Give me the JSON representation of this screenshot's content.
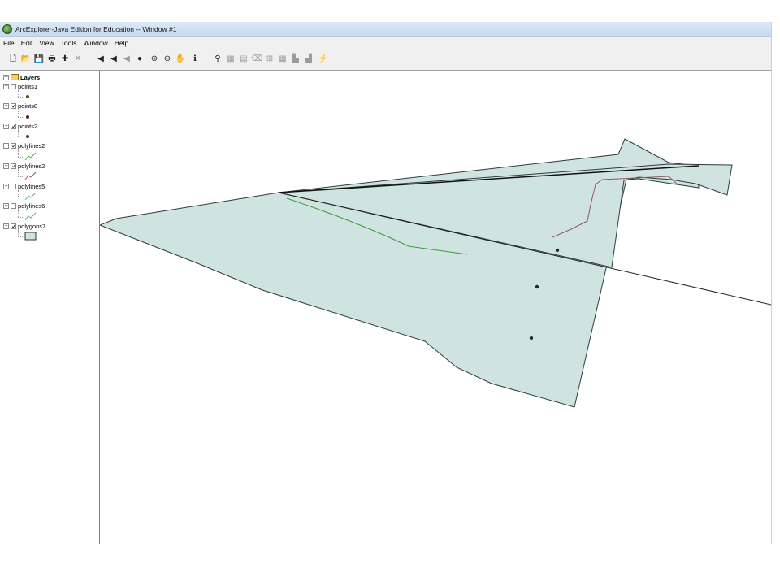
{
  "window": {
    "title": "ArcExplorer-Java Edition for Education -- Window #1"
  },
  "menu": [
    "File",
    "Edit",
    "View",
    "Tools",
    "Window",
    "Help"
  ],
  "toolbar": {
    "buttons": [
      {
        "name": "new-icon",
        "glyph": "🗋"
      },
      {
        "name": "open-folder-icon",
        "glyph": "📂"
      },
      {
        "name": "save-icon",
        "glyph": "💾"
      },
      {
        "name": "print-icon",
        "glyph": "🖶"
      },
      {
        "name": "add-layer-icon",
        "glyph": "✚"
      },
      {
        "name": "delete-icon",
        "glyph": "✕",
        "dim": true
      },
      {
        "name": "back-arrow-icon",
        "glyph": "◀"
      },
      {
        "name": "previous-extent-icon",
        "glyph": "◀"
      },
      {
        "name": "next-extent-icon",
        "glyph": "◀",
        "dim": true
      },
      {
        "name": "full-extent-globe-icon",
        "glyph": "●"
      },
      {
        "name": "zoom-in-icon",
        "glyph": "⊕"
      },
      {
        "name": "zoom-out-icon",
        "glyph": "⊖"
      },
      {
        "name": "pan-hand-icon",
        "glyph": "✋"
      },
      {
        "name": "identify-icon",
        "glyph": "ℹ"
      },
      {
        "name": "find-binoculars-icon",
        "glyph": "⚲"
      },
      {
        "name": "select-feature-icon",
        "glyph": "▦",
        "dim": true
      },
      {
        "name": "query-builder-icon",
        "glyph": "▤",
        "dim": true
      },
      {
        "name": "clear-selection-icon",
        "glyph": "⌫",
        "dim": true
      },
      {
        "name": "measure-icon",
        "glyph": "⊞",
        "dim": true
      },
      {
        "name": "attribute-table-icon",
        "glyph": "▦",
        "dim": true
      },
      {
        "name": "chart-icon",
        "glyph": "▙",
        "dim": true
      },
      {
        "name": "buffer-icon",
        "glyph": "▟",
        "dim": true
      },
      {
        "name": "hotlink-icon",
        "glyph": "⚡",
        "dim": true
      }
    ]
  },
  "layers": {
    "root_label": "Layers",
    "items": [
      {
        "label": "points1",
        "checked": false,
        "kind": "point",
        "color": "#3b5e1f"
      },
      {
        "label": "points8",
        "checked": true,
        "kind": "point",
        "color": "#5a1e1e"
      },
      {
        "label": "points2",
        "checked": true,
        "kind": "point",
        "color": "#3a3a14"
      },
      {
        "label": "polylines2",
        "checked": true,
        "kind": "line",
        "color": "#3db33d"
      },
      {
        "label": "polylines2",
        "checked": true,
        "kind": "line",
        "color": "#a05a6a"
      },
      {
        "label": "polylines5",
        "checked": false,
        "kind": "line",
        "color": "#4cb8a0"
      },
      {
        "label": "polylines6",
        "checked": false,
        "kind": "line",
        "color": "#58b06a"
      },
      {
        "label": "polygons7",
        "checked": true,
        "kind": "polygon",
        "color": "#cfe3e1"
      }
    ]
  },
  "map": {
    "polygon_fill": "#cfe3e1",
    "outline_color": "#2f3b3b",
    "green_line_color": "#3a9a3a",
    "maroon_line_color": "#8c5a66",
    "point_color": "#2b2b14"
  }
}
